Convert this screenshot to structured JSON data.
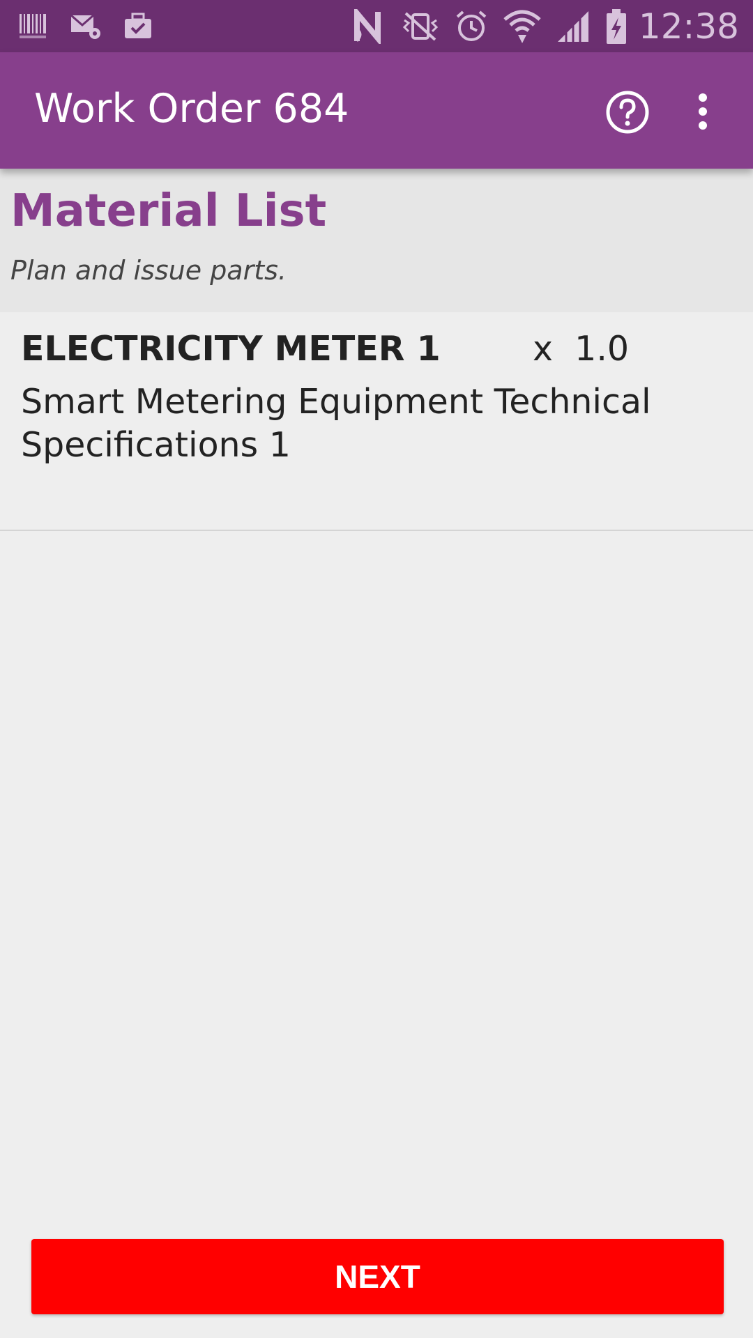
{
  "status_bar": {
    "time": "12:38",
    "icons": [
      "barcode-icon",
      "mail-settings-icon",
      "briefcase-check-icon",
      "nfc-icon",
      "vibrate-mute-icon",
      "alarm-icon",
      "wifi-icon",
      "signal-icon",
      "battery-charging-icon"
    ]
  },
  "app_bar": {
    "title": "Work Order 684",
    "background": "#873f8c"
  },
  "section": {
    "title": "Material List",
    "subtitle": "Plan and issue parts."
  },
  "materials": [
    {
      "name": "ELECTRICITY METER 1",
      "quantity": "x  1.0",
      "description": "Smart Metering Equipment Technical Specifications 1"
    }
  ],
  "actions": {
    "next_label": "NEXT",
    "next_color": "#ff0000"
  }
}
